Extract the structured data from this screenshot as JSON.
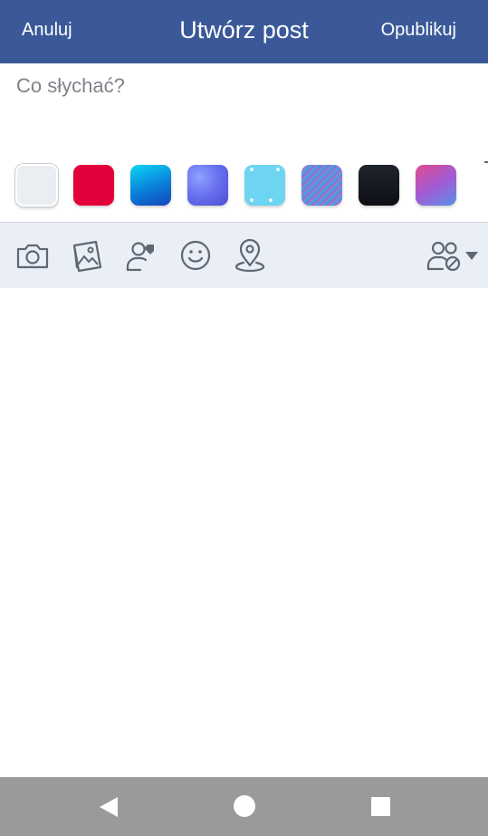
{
  "header": {
    "cancel_label": "Anuluj",
    "title": "Utwórz post",
    "publish_label": "Opublikuj",
    "background_color": "#3b5998"
  },
  "composer": {
    "placeholder": "Co słychać?",
    "value": ""
  },
  "backgrounds": {
    "selected_index": 0,
    "items": [
      {
        "name": "plain",
        "color": "#eaedf2"
      },
      {
        "name": "red",
        "color": "#e4003a"
      },
      {
        "name": "blue-gradient",
        "color": "#0a7fd9"
      },
      {
        "name": "purple-pattern",
        "color": "#6a72f0"
      },
      {
        "name": "light-blue-sparkle",
        "color": "#6dd4f2"
      },
      {
        "name": "striped",
        "color": "#7b78d8"
      },
      {
        "name": "black",
        "color": "#0d0f14"
      },
      {
        "name": "pink-purple-gradient",
        "color": "#a35ad4"
      }
    ]
  },
  "toolbar": {
    "background_color": "#e9eef7",
    "icon_color": "#606770",
    "tools": [
      {
        "name": "camera-icon"
      },
      {
        "name": "photo-icon"
      },
      {
        "name": "tag-people-icon"
      },
      {
        "name": "feeling-icon"
      },
      {
        "name": "location-icon"
      }
    ],
    "audience": {
      "name": "friends-audience-icon"
    }
  },
  "navbar": {
    "background_color": "#9a9a9a",
    "buttons": [
      "back-icon",
      "home-icon",
      "recent-apps-icon"
    ]
  }
}
